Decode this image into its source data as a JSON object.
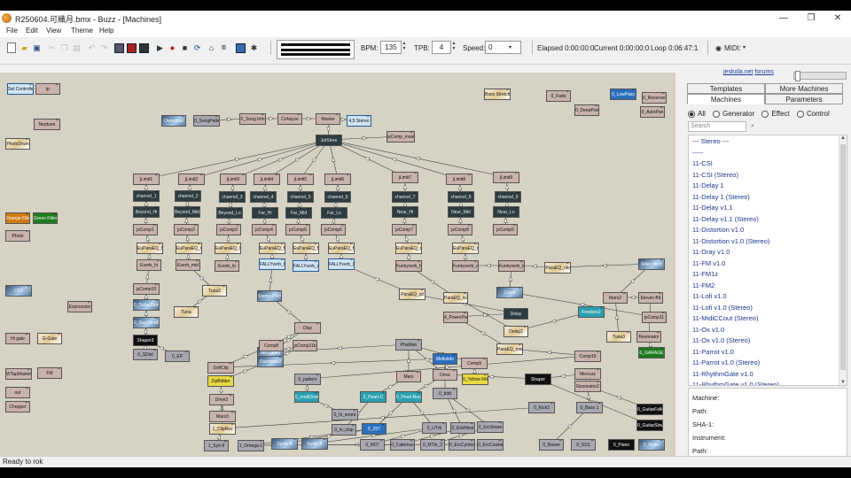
{
  "window": {
    "title": "R250604.可織月.bmx - Buzz - [Machines]",
    "minimize": "—",
    "maximize": "❐",
    "close": "✕"
  },
  "menu": [
    "File",
    "Edit",
    "View",
    "Theme",
    "Help"
  ],
  "toolbar": {
    "bpm_label": "BPM:",
    "bpm_value": "135",
    "tpb_label": "TPB:",
    "tpb_value": "4",
    "speed_label": "Speed:",
    "speed_value": "0",
    "elapsed": "Elapsed 0:00:00:0",
    "current": "Current 0:00:00:0",
    "loop": "Loop 0:06:47:1",
    "midi_label": "MIDI:",
    "icons": [
      "new-icon",
      "open-icon",
      "save-icon",
      "cut-icon",
      "copy-icon",
      "paste-icon",
      "undo-icon",
      "redo-icon",
      "cpu-icon",
      "pattern-icon",
      "sequence-icon",
      "play-icon",
      "record-icon",
      "stop-icon",
      "loop-icon",
      "machine-icon",
      "wavetable-icon",
      "info-icon",
      "settings-icon"
    ]
  },
  "panel": {
    "link_text": "jeskola.net",
    "link_text2": "forums",
    "tabs_top": [
      "Templates",
      "More Machines"
    ],
    "tabs_bottom": [
      "Machines",
      "Parameters"
    ],
    "filters": [
      "All",
      "Generator",
      "Effect",
      "Control"
    ],
    "selected_filter": "All",
    "search_placeholder": "Search",
    "list": [
      "--- Stereo ---",
      "-----",
      "11-CSI",
      "11-CSI (Stereo)",
      "11-Delay 1",
      "11-Delay 1 (Stereo)",
      "11-Delay v1.1",
      "11-Delay v1.1 (Stereo)",
      "11-Distortion v1.0",
      "11-Distortion v1.0 (Stereo)",
      "11-Dray v1.0",
      "11-FM v1.0",
      "11-FM1z",
      "11-FM2",
      "11-Lofi v1.0",
      "11-Lofi v1.0 (Stereo)",
      "11-MidiCCout (Stereo)",
      "11-Ox v1.0",
      "11-Ox v1.0 (Stereo)",
      "11-Parrot v1.0",
      "11-Parrot v1.0 (Stereo)",
      "11-RhythmGate v1.0",
      "11-RhythmGate v1.0 (Stereo)"
    ],
    "info_labels": [
      "Machine:",
      "Path:",
      "SHA-1:",
      "Instrument:",
      "Path:"
    ]
  },
  "machines": [
    {
      "label": "Sel Controller",
      "t": "lightblue"
    },
    {
      "label": "tp",
      "t": "ef"
    },
    {
      "label": "Neptune",
      "t": "ef"
    },
    {
      "label": "PhotoDrum",
      "t": "imgw"
    },
    {
      "label": "Orange Filter",
      "t": "orange"
    },
    {
      "label": "Green Filter",
      "t": "green"
    },
    {
      "label": "Photo",
      "t": "ef"
    },
    {
      "label": "CRT",
      "t": "img"
    },
    {
      "label": "Expression",
      "t": "ef"
    },
    {
      "label": "Hi gate",
      "t": "ef"
    },
    {
      "label": "G-Gate",
      "t": "imgw"
    },
    {
      "label": "WTapMaster",
      "t": "ef"
    },
    {
      "label": "FM",
      "t": "ef"
    },
    {
      "label": "out",
      "t": "ef"
    },
    {
      "label": "Chopper",
      "t": "ef"
    },
    {
      "label": "Overdrive",
      "t": "img"
    },
    {
      "label": "0_SongPattern",
      "t": "gray"
    },
    {
      "label": "0_Song Info",
      "t": "ef"
    },
    {
      "label": "Cefalyze",
      "t": "ef"
    },
    {
      "label": "Master",
      "t": "ef"
    },
    {
      "label": "4,5 Stereo",
      "t": "lightblue"
    },
    {
      "label": "JetStere",
      "t": "gen"
    },
    {
      "label": "jsComp_master",
      "t": "ef"
    },
    {
      "label": "Bass Stretch",
      "t": "imgw"
    },
    {
      "label": "0_Fade",
      "t": "ef"
    },
    {
      "label": "0_LowPass",
      "t": "blue"
    },
    {
      "label": "0_Reverser",
      "t": "ef"
    },
    {
      "label": "0_DeepPan",
      "t": "ef"
    },
    {
      "label": "0_AutoPan",
      "t": "ef"
    },
    {
      "label": "jLimit1",
      "t": "ef"
    },
    {
      "label": "jLimit2",
      "t": "ef"
    },
    {
      "label": "jLimit3",
      "t": "ef"
    },
    {
      "label": "jLimit4",
      "t": "ef"
    },
    {
      "label": "jLimit5",
      "t": "ef"
    },
    {
      "label": "jLimit6",
      "t": "ef"
    },
    {
      "label": "jLimit7",
      "t": "ef"
    },
    {
      "label": "jLimit8",
      "t": "ef"
    },
    {
      "label": "jLimit9",
      "t": "ef"
    },
    {
      "label": "channel_1",
      "t": "gen"
    },
    {
      "label": "channel_2",
      "t": "gen"
    },
    {
      "label": "channel_3",
      "t": "gen"
    },
    {
      "label": "channel_4",
      "t": "gen"
    },
    {
      "label": "channel_5",
      "t": "gen"
    },
    {
      "label": "channel_6",
      "t": "gen"
    },
    {
      "label": "channel_7",
      "t": "gen"
    },
    {
      "label": "channel_8",
      "t": "gen"
    },
    {
      "label": "channel_9",
      "t": "gen"
    },
    {
      "label": "Beyond_Hi",
      "t": "gen"
    },
    {
      "label": "Beyond_Mid",
      "t": "gen"
    },
    {
      "label": "Beyond_Lo",
      "t": "gen"
    },
    {
      "label": "Far_Hi",
      "t": "gen"
    },
    {
      "label": "Far_Mid",
      "t": "gen"
    },
    {
      "label": "Far_Lo",
      "t": "gen"
    },
    {
      "label": "Near_Hi",
      "t": "gen"
    },
    {
      "label": "Near_Mid",
      "t": "gen"
    },
    {
      "label": "Near_Lo",
      "t": "gen"
    },
    {
      "label": "jsComp1",
      "t": "ef"
    },
    {
      "label": "jsComp2",
      "t": "ef"
    },
    {
      "label": "jsComp3",
      "t": "ef"
    },
    {
      "label": "jsComp4",
      "t": "ef"
    },
    {
      "label": "jsComp5",
      "t": "ef"
    },
    {
      "label": "jsComp6",
      "t": "ef"
    },
    {
      "label": "jsComp7",
      "t": "ef"
    },
    {
      "label": "jsComp8",
      "t": "ef"
    },
    {
      "label": "jsComp9",
      "t": "ef"
    },
    {
      "label": "EuParaEQ_hi",
      "t": "imgw"
    },
    {
      "label": "EuParaEQ_mid",
      "t": "imgw"
    },
    {
      "label": "EuParaEQ_lo",
      "t": "imgw"
    },
    {
      "label": "EuParaEQ_fh",
      "t": "imgw"
    },
    {
      "label": "EuParaEQ_fm",
      "t": "imgw"
    },
    {
      "label": "EuParaEQ_fl",
      "t": "imgw"
    },
    {
      "label": "EuParaEQ_nh",
      "t": "imgw"
    },
    {
      "label": "EuParaEQ_nm",
      "t": "imgw"
    },
    {
      "label": "Everb_hi",
      "t": "ef"
    },
    {
      "label": "Everb_mid",
      "t": "ef"
    },
    {
      "label": "Everb_lo",
      "t": "ef"
    },
    {
      "label": "FALLYverb_hi",
      "t": "lightblue"
    },
    {
      "label": "FALLYverb_mid",
      "t": "lightblue"
    },
    {
      "label": "FALLYverb_lo",
      "t": "lightblue"
    },
    {
      "label": "Funkyverb_hi",
      "t": "ef"
    },
    {
      "label": "Funkyverb_mid",
      "t": "ef"
    },
    {
      "label": "Funkyverb_lo",
      "t": "ef"
    },
    {
      "label": "ParaEQ_nlo",
      "t": "imgw"
    },
    {
      "label": "Filter Pitch",
      "t": "img"
    },
    {
      "label": "jsComp10",
      "t": "ef"
    },
    {
      "label": "Tuna2",
      "t": "imgw"
    },
    {
      "label": "Stereo Pitch",
      "t": "img"
    },
    {
      "label": "ParaEQ_all",
      "t": "imgw"
    },
    {
      "label": "ParaEQ_lo2",
      "t": "imgw"
    },
    {
      "label": "Crush",
      "t": "img"
    },
    {
      "label": "Mars2",
      "t": "ef"
    },
    {
      "label": "Eleven Bit",
      "t": "ef"
    },
    {
      "label": "0_DelayStereo",
      "t": "img"
    },
    {
      "label": "Tuna",
      "t": "imgw"
    },
    {
      "label": "Delay",
      "t": "gen"
    },
    {
      "label": "Delay2",
      "t": "imgw"
    },
    {
      "label": "4_PowerPan",
      "t": "ef"
    },
    {
      "label": "jsComp11",
      "t": "ef"
    },
    {
      "label": "Tuna3",
      "t": "imgw"
    },
    {
      "label": "Resonator",
      "t": "ef"
    },
    {
      "label": "0_DaySliceB",
      "t": "img"
    },
    {
      "label": "Dlay",
      "t": "ef"
    },
    {
      "label": "Freeboo2",
      "t": "teal"
    },
    {
      "label": "ParaEQ_mix",
      "t": "imgw"
    },
    {
      "label": "Mix Delay",
      "t": "img"
    },
    {
      "label": "0_GARAGE",
      "t": "green"
    },
    {
      "label": "Shaper3",
      "t": "dark"
    },
    {
      "label": "Comp8",
      "t": "ef"
    },
    {
      "label": "jsComp11b",
      "t": "ef"
    },
    {
      "label": "Comp10",
      "t": "ef"
    },
    {
      "label": "0_SDist",
      "t": "gray"
    },
    {
      "label": "0_EP",
      "t": "gray"
    },
    {
      "label": "SoftClip",
      "t": "ef"
    },
    {
      "label": "PhaMan",
      "t": "gray"
    },
    {
      "label": "Mellotide",
      "t": "blue"
    },
    {
      "label": "Comp9",
      "t": "ef"
    },
    {
      "label": "Overdrive2",
      "t": "img"
    },
    {
      "label": "0_pattern",
      "t": "gray"
    },
    {
      "label": "Mars",
      "t": "ef"
    },
    {
      "label": "Drive",
      "t": "ef"
    },
    {
      "label": "0_Yellow Filter",
      "t": "yellow"
    },
    {
      "label": "Shaper",
      "t": "dark"
    },
    {
      "label": "Mercury",
      "t": "ef"
    },
    {
      "label": "ZipBidder",
      "t": "yellow"
    },
    {
      "label": "Drive2",
      "t": "ef"
    },
    {
      "label": "0_modDrive",
      "t": "teal"
    },
    {
      "label": "0_Pearl-C",
      "t": "teal"
    },
    {
      "label": "0_Pearl-Boost",
      "t": "teal"
    },
    {
      "label": "0_bdd",
      "t": "gray"
    },
    {
      "label": "Resonator2",
      "t": "ef"
    },
    {
      "label": "Mars3",
      "t": "ef"
    },
    {
      "label": "0_hi_snare",
      "t": "gray"
    },
    {
      "label": "0_GuitarFolk",
      "t": "dark"
    },
    {
      "label": "0_Bass 1",
      "t": "gray"
    },
    {
      "label": "0_GuitarSlow",
      "t": "dark"
    },
    {
      "label": "1_ClipRev",
      "t": "imgw"
    },
    {
      "label": "0_lo_clap",
      "t": "gray"
    },
    {
      "label": "0_Z07",
      "t": "blue"
    },
    {
      "label": "0_UTrb",
      "t": "gray"
    },
    {
      "label": "0_ErbHihat",
      "t": "gray"
    },
    {
      "label": "0_ErcSnare",
      "t": "gray"
    },
    {
      "label": "0_Kick2",
      "t": "gray"
    },
    {
      "label": "1_Syn-II",
      "t": "gray"
    },
    {
      "label": "1_Omega-1",
      "t": "gray"
    },
    {
      "label": "Synth A",
      "t": "img"
    },
    {
      "label": "Synth B",
      "t": "img"
    },
    {
      "label": "0_M07",
      "t": "gray"
    },
    {
      "label": "0_Cafemus",
      "t": "gray"
    },
    {
      "label": "0_MTin_2",
      "t": "gray"
    },
    {
      "label": "0_ErcCymbal",
      "t": "gray"
    },
    {
      "label": "0_ErcCowbell",
      "t": "gray"
    },
    {
      "label": "0_Basse",
      "t": "gray"
    },
    {
      "label": "0_SSS",
      "t": "gray"
    },
    {
      "label": "0_Piano",
      "t": "dark"
    },
    {
      "label": "0_Noise",
      "t": "img"
    }
  ],
  "status": "Ready to rok"
}
